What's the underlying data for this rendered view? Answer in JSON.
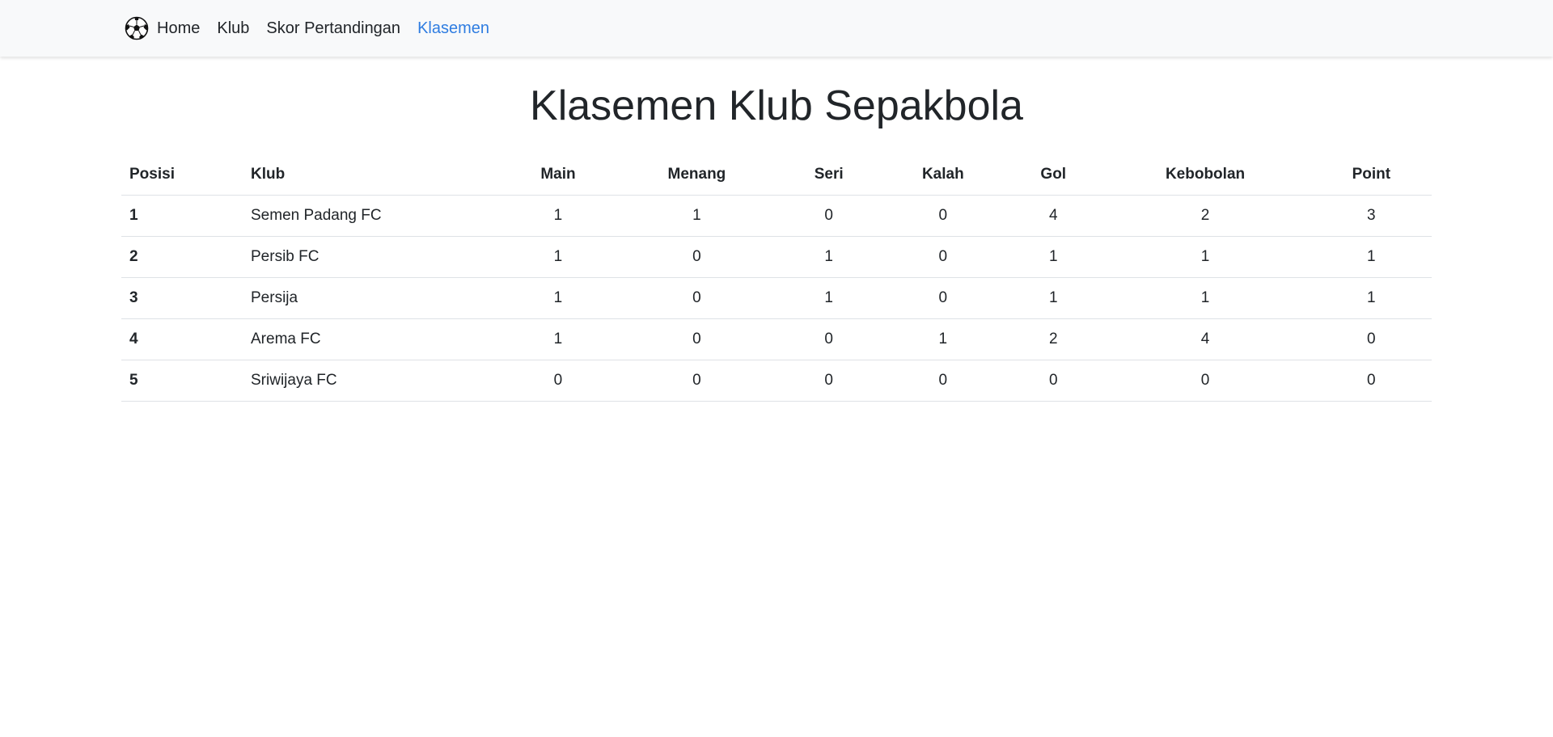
{
  "nav": {
    "brand_icon": "soccer-ball-icon",
    "items": [
      {
        "label": "Home",
        "active": false
      },
      {
        "label": "Klub",
        "active": false
      },
      {
        "label": "Skor Pertandingan",
        "active": false
      },
      {
        "label": "Klasemen",
        "active": true
      }
    ],
    "active_color": "#2f7de1"
  },
  "page": {
    "title": "Klasemen Klub Sepakbola"
  },
  "table": {
    "headers": [
      "Posisi",
      "Klub",
      "Main",
      "Menang",
      "Seri",
      "Kalah",
      "Gol",
      "Kebobolan",
      "Point"
    ],
    "rows": [
      [
        "1",
        "Semen Padang FC",
        "1",
        "1",
        "0",
        "0",
        "4",
        "2",
        "3"
      ],
      [
        "2",
        "Persib FC",
        "1",
        "0",
        "1",
        "0",
        "1",
        "1",
        "1"
      ],
      [
        "3",
        "Persija",
        "1",
        "0",
        "1",
        "0",
        "1",
        "1",
        "1"
      ],
      [
        "4",
        "Arema FC",
        "1",
        "0",
        "0",
        "1",
        "2",
        "4",
        "0"
      ],
      [
        "5",
        "Sriwijaya FC",
        "0",
        "0",
        "0",
        "0",
        "0",
        "0",
        "0"
      ]
    ]
  }
}
